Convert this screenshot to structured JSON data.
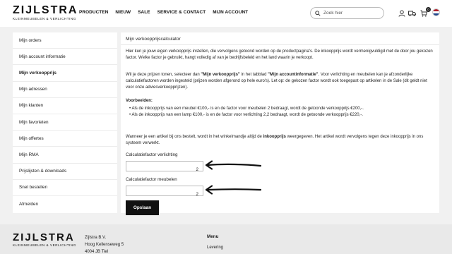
{
  "header": {
    "logo_main": "ZIJLSTRA",
    "logo_sub": "KLEINMEUBELEN & VERLICHTING",
    "nav": [
      "PRODUCTEN",
      "NIEUW",
      "SALE",
      "SERVICE & CONTACT",
      "MIJN ACCOUNT"
    ],
    "search_placeholder": "Zoek hier",
    "cart_count": "0",
    "icons": [
      "search-icon",
      "user-icon",
      "truck-icon",
      "cart-icon",
      "flag-nl-icon"
    ]
  },
  "sidebar": {
    "items": [
      {
        "label": "Mijn orders"
      },
      {
        "label": "Mijn account informatie"
      },
      {
        "label": "Mijn verkoopprijs"
      },
      {
        "label": "Mijn adressen"
      },
      {
        "label": "Mijn klanten"
      },
      {
        "label": "Mijn favorieten"
      },
      {
        "label": "Mijn offertes"
      },
      {
        "label": "Mijn RMA"
      },
      {
        "label": "Prijslijsten & downloads"
      },
      {
        "label": "Snel bestellen"
      },
      {
        "label": "Afmelden"
      }
    ],
    "active": "Mijn verkoopprijs"
  },
  "content": {
    "title": "Mijn verkoopprijscalculator",
    "p1": "Hier kun je jouw eigen verkoopprijs instellen, die vervolgens getoond worden op de productpagina's. De inkoopprijs wordt vermenigvuldigd met de door jou gekozen factor. Welke factor je gebruikt, hangt volledig af van je bedrijfsbeleid en het land waarin je verkoopt.",
    "p2_a": "Wil je deze prijzen tonen, selecteer dan ",
    "p2_b1": "\"Mijn verkoopprijs\"",
    "p2_c": " in het tabblad ",
    "p2_b2": "\"Mijn accountinformatie\"",
    "p2_d": ". Voor verlichting en meubelen kan je afzonderlijke calculatiefactoren worden ingesteld (prijzen worden afgerond op hele euro's). Let op: de gekozen factor wordt ook toegepast op artikelen in de Sale (dit geldt niet voor onze adviesverkoopprijzen).",
    "examples_title": "Voorbeelden:",
    "example1": "Als de inkoopprijs van een meubel €100,- is en de factor voor meubelen 2 bedraagt, wordt de getoonde verkoopprijs €200,-.",
    "example2": "Als de inkoopprijs van een lamp €100,- is en de factor voor verlichting 2,2 bedraagt, wordt de getoonde verkoopprijs €220,-.",
    "p3_a": "Wanneer je een artikel bij ons bestelt, wordt in het winkelmandje altijd de ",
    "p3_b": "inkoopprijs",
    "p3_c": " weergegeven. Het artikel wordt vervolgens tegen deze inkoopprijs in ons systeem verwerkt.",
    "field1_label": "Calculatiefactor verlichting",
    "field1_value": "2",
    "field2_label": "Calculatiefactor meubelen",
    "field2_value": "2",
    "save_label": "Opslaan"
  },
  "footer": {
    "logo_main": "ZIJLSTRA",
    "logo_sub": "KLEINMEUBELEN & VERLICHTING",
    "address": [
      "Zijlstra B.V.",
      "Hoog Kellenseweg 5",
      "4004 JB Tiel"
    ],
    "menu_title": "Menu",
    "menu_items": [
      "Levering"
    ]
  }
}
